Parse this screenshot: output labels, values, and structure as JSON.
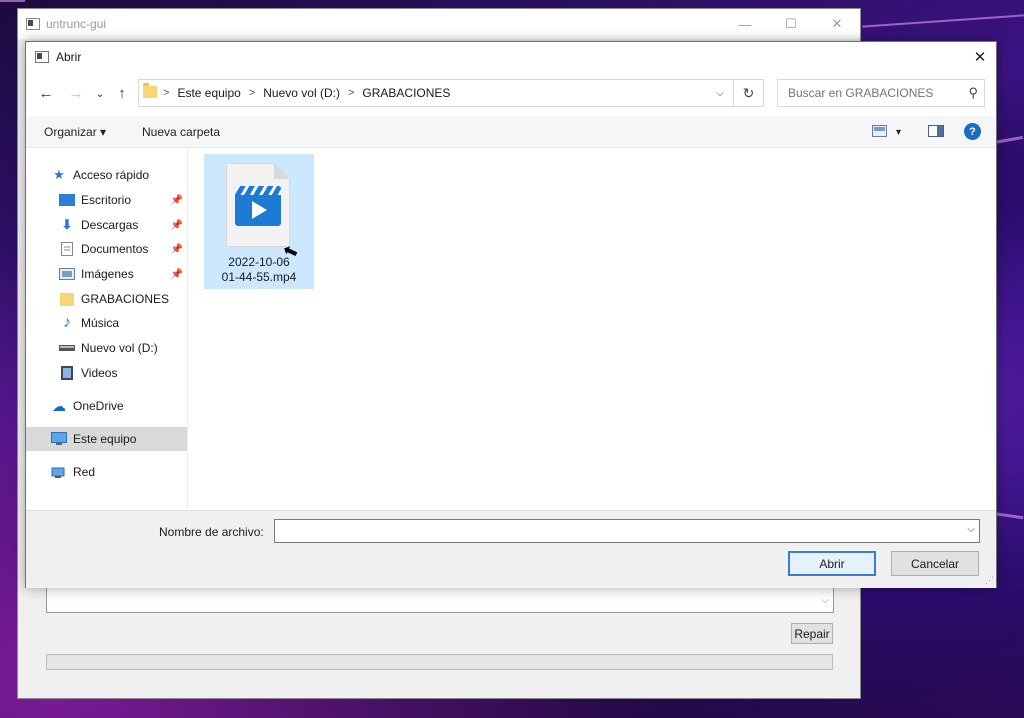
{
  "background_window": {
    "title": "untrunc-gui",
    "minimize_glyph": "—",
    "maximize_glyph": "☐",
    "close_glyph": "✕",
    "dropdown_glyph": "⌵",
    "repair_label": "Repair"
  },
  "dialog": {
    "title": "Abrir",
    "close_glyph": "✕",
    "nav": {
      "back_glyph": "←",
      "forward_glyph": "→",
      "recent_glyph": "⌄",
      "up_glyph": "↑"
    },
    "address": {
      "crumbs": [
        "Este equipo",
        "Nuevo vol (D:)",
        "GRABACIONES"
      ],
      "separator": ">",
      "dropdown_glyph": "⌵",
      "refresh_glyph": "↻"
    },
    "search": {
      "placeholder": "Buscar en GRABACIONES",
      "icon_glyph": "⚲"
    },
    "toolbar": {
      "organize": "Organizar ▾",
      "new_folder": "Nueva carpeta",
      "view_dropdown_glyph": "▾",
      "help_glyph": "?"
    },
    "nav_pane": {
      "quick_access": "Acceso rápido",
      "items": [
        {
          "label": "Escritorio",
          "pinned": true
        },
        {
          "label": "Descargas",
          "pinned": true
        },
        {
          "label": "Documentos",
          "pinned": true
        },
        {
          "label": "Imágenes",
          "pinned": true
        },
        {
          "label": "GRABACIONES",
          "pinned": false
        },
        {
          "label": "Música",
          "pinned": false
        },
        {
          "label": "Nuevo vol (D:)",
          "pinned": false
        },
        {
          "label": "Videos",
          "pinned": false
        }
      ],
      "pin_glyph": "📌",
      "onedrive": "OneDrive",
      "this_pc": "Este equipo",
      "network": "Red"
    },
    "files": [
      {
        "name_line1": "2022-10-06",
        "name_line2": "01-44-55.mp4",
        "selected": true
      }
    ],
    "cursor_glyph": "⬉",
    "bottom": {
      "filename_label": "Nombre de archivo:",
      "filename_value": "",
      "dropdown_glyph": "⌵",
      "open_label": "Abrir",
      "cancel_label": "Cancelar",
      "grip_glyph": "⋰"
    }
  },
  "colors": {
    "selection": "#cce8ff",
    "accent": "#3a7bd5",
    "folder": "#f7d774",
    "help": "#1b6cc4"
  }
}
